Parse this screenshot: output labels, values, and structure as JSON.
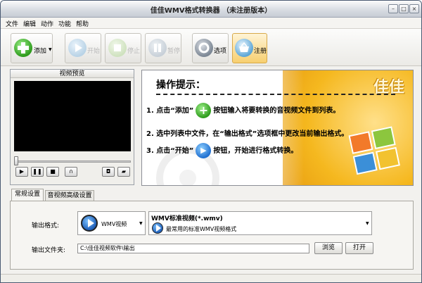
{
  "window": {
    "title": "佳佳WMV格式转换器 （未注册版本）",
    "min": "–",
    "max": "□",
    "close": "×"
  },
  "menu": [
    "文件",
    "编辑",
    "动作",
    "功能",
    "帮助"
  ],
  "toolbar": {
    "add": "添加",
    "start": "开始",
    "stop": "停止",
    "pause": "暂停",
    "options": "选项",
    "register": "注册"
  },
  "preview": {
    "title": "视频预览"
  },
  "hint": {
    "title": "操作提示：",
    "step1_a": "1. 点击“添加”",
    "step1_b": "按钮输入将要转换的音视频文件到列表。",
    "step2": "2. 选中列表中文件，在“输出格式”选项框中更改当前输出格式。",
    "step3_a": "3. 点击“开始”",
    "step3_b": "按钮，开始进行格式转换。",
    "logo": "佳佳"
  },
  "tabs": [
    "常规设置",
    "音视频高级设置"
  ],
  "settings": {
    "format_label": "输出格式:",
    "format_value": "WMV视频",
    "format_title": "WMV标准视频(*.wmv)",
    "format_desc": "最常用的标准WMV视频格式",
    "folder_label": "输出文件夹:",
    "folder_path": "C:\\佳佳视频软件\\输出",
    "browse": "浏览",
    "open": "打开"
  }
}
